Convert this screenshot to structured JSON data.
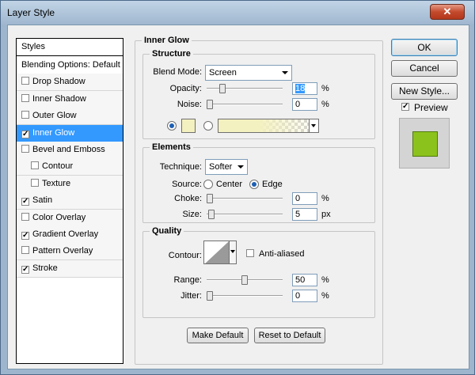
{
  "window": {
    "title": "Layer Style",
    "close_glyph": "✕"
  },
  "styles_list": {
    "header": "Styles",
    "items": [
      {
        "label": "Blending Options: Default",
        "checkbox": false,
        "checked": false,
        "selected": false,
        "sub": false
      },
      {
        "label": "Drop Shadow",
        "checkbox": true,
        "checked": false,
        "selected": false,
        "sub": false
      },
      {
        "label": "Inner Shadow",
        "checkbox": true,
        "checked": false,
        "selected": false,
        "sub": false
      },
      {
        "label": "Outer Glow",
        "checkbox": true,
        "checked": false,
        "selected": false,
        "sub": false
      },
      {
        "label": "Inner Glow",
        "checkbox": true,
        "checked": true,
        "selected": true,
        "sub": false
      },
      {
        "label": "Bevel and Emboss",
        "checkbox": true,
        "checked": false,
        "selected": false,
        "sub": false
      },
      {
        "label": "Contour",
        "checkbox": true,
        "checked": false,
        "selected": false,
        "sub": true
      },
      {
        "label": "Texture",
        "checkbox": true,
        "checked": false,
        "selected": false,
        "sub": true
      },
      {
        "label": "Satin",
        "checkbox": true,
        "checked": true,
        "selected": false,
        "sub": false
      },
      {
        "label": "Color Overlay",
        "checkbox": true,
        "checked": false,
        "selected": false,
        "sub": false
      },
      {
        "label": "Gradient Overlay",
        "checkbox": true,
        "checked": true,
        "selected": false,
        "sub": false
      },
      {
        "label": "Pattern Overlay",
        "checkbox": true,
        "checked": false,
        "selected": false,
        "sub": false
      },
      {
        "label": "Stroke",
        "checkbox": true,
        "checked": true,
        "selected": false,
        "sub": false
      }
    ]
  },
  "inner_glow": {
    "title": "Inner Glow",
    "structure": {
      "title": "Structure",
      "blend_mode_label": "Blend Mode:",
      "blend_mode_value": "Screen",
      "opacity_label": "Opacity:",
      "opacity_value": "18",
      "opacity_level": 0.18,
      "noise_label": "Noise:",
      "noise_value": "0",
      "noise_level": 0,
      "unit_percent": "%",
      "color_swatch": "#f4f1c0",
      "color_radio_on": true,
      "gradient_radio_on": false
    },
    "elements": {
      "title": "Elements",
      "technique_label": "Technique:",
      "technique_value": "Softer",
      "source_label": "Source:",
      "source_center": "Center",
      "source_edge": "Edge",
      "source_selected": "Edge",
      "choke_label": "Choke:",
      "choke_value": "0",
      "choke_level": 0,
      "size_label": "Size:",
      "size_value": "5",
      "size_level": 0.02,
      "unit_percent": "%",
      "unit_px": "px"
    },
    "quality": {
      "title": "Quality",
      "contour_label": "Contour:",
      "anti_aliased_label": "Anti-aliased",
      "anti_aliased_checked": false,
      "range_label": "Range:",
      "range_value": "50",
      "range_level": 0.5,
      "jitter_label": "Jitter:",
      "jitter_value": "0",
      "jitter_level": 0,
      "unit_percent": "%"
    },
    "make_default": "Make Default",
    "reset_default": "Reset to Default"
  },
  "actions": {
    "ok": "OK",
    "cancel": "Cancel",
    "new_style": "New Style...",
    "preview_label": "Preview",
    "preview_checked": true,
    "preview_color": "#8cc21c"
  },
  "colors": {
    "accent": "#3399ff",
    "window_frame": "#9eb6cd"
  }
}
